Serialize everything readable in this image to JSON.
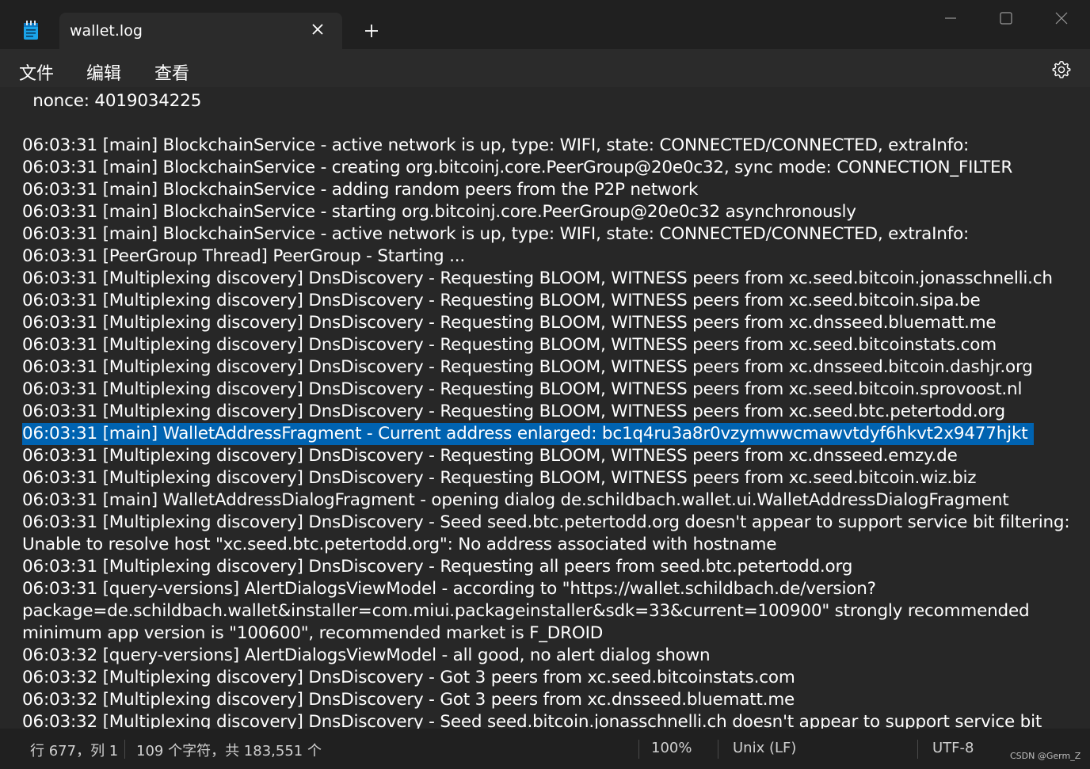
{
  "tab": {
    "title": "wallet.log"
  },
  "menu": {
    "file": "文件",
    "edit": "编辑",
    "view": "查看"
  },
  "icons": {
    "app": "notepad-icon",
    "close_tab": "close-icon",
    "new_tab": "plus-icon",
    "minimize": "minimize-icon",
    "maximize": "maximize-icon",
    "close_window": "close-icon",
    "settings": "gear-icon"
  },
  "colors": {
    "selection": "#0063b1",
    "background": "#272727",
    "text": "#ffffff"
  },
  "lines": [
    "  nonce: 4019034225",
    "",
    "06:03:31 [main] BlockchainService - active network is up, type: WIFI, state: CONNECTED/CONNECTED, extraInfo:",
    "06:03:31 [main] BlockchainService - creating org.bitcoinj.core.PeerGroup@20e0c32, sync mode: CONNECTION_FILTER",
    "06:03:31 [main] BlockchainService - adding random peers from the P2P network",
    "06:03:31 [main] BlockchainService - starting org.bitcoinj.core.PeerGroup@20e0c32 asynchronously",
    "06:03:31 [main] BlockchainService - active network is up, type: WIFI, state: CONNECTED/CONNECTED, extraInfo:",
    "06:03:31 [PeerGroup Thread] PeerGroup - Starting ...",
    "06:03:31 [Multiplexing discovery] DnsDiscovery - Requesting BLOOM, WITNESS peers from xc.seed.bitcoin.jonasschnelli.ch",
    "06:03:31 [Multiplexing discovery] DnsDiscovery - Requesting BLOOM, WITNESS peers from xc.seed.bitcoin.sipa.be",
    "06:03:31 [Multiplexing discovery] DnsDiscovery - Requesting BLOOM, WITNESS peers from xc.dnsseed.bluematt.me",
    "06:03:31 [Multiplexing discovery] DnsDiscovery - Requesting BLOOM, WITNESS peers from xc.seed.bitcoinstats.com",
    "06:03:31 [Multiplexing discovery] DnsDiscovery - Requesting BLOOM, WITNESS peers from xc.dnsseed.bitcoin.dashjr.org",
    "06:03:31 [Multiplexing discovery] DnsDiscovery - Requesting BLOOM, WITNESS peers from xc.seed.bitcoin.sprovoost.nl",
    "06:03:31 [Multiplexing discovery] DnsDiscovery - Requesting BLOOM, WITNESS peers from xc.seed.btc.petertodd.org",
    "06:03:31 [main] WalletAddressFragment - Current address enlarged: bc1q4ru3a8r0vzymwwcmawvtdyf6hkvt2x9477hjkt",
    "06:03:31 [Multiplexing discovery] DnsDiscovery - Requesting BLOOM, WITNESS peers from xc.dnsseed.emzy.de",
    "06:03:31 [Multiplexing discovery] DnsDiscovery - Requesting BLOOM, WITNESS peers from xc.seed.bitcoin.wiz.biz",
    "06:03:31 [main] WalletAddressDialogFragment - opening dialog de.schildbach.wallet.ui.WalletAddressDialogFragment",
    "06:03:31 [Multiplexing discovery] DnsDiscovery - Seed seed.btc.petertodd.org doesn't appear to support service bit filtering:",
    "Unable to resolve host \"xc.seed.btc.petertodd.org\": No address associated with hostname",
    "06:03:31 [Multiplexing discovery] DnsDiscovery - Requesting all peers from seed.btc.petertodd.org",
    "06:03:31 [query-versions] AlertDialogsViewModel - according to \"https://wallet.schildbach.de/version?",
    "package=de.schildbach.wallet&installer=com.miui.packageinstaller&sdk=33&current=100900\" strongly recommended",
    "minimum app version is \"100600\", recommended market is F_DROID",
    "06:03:32 [query-versions] AlertDialogsViewModel - all good, no alert dialog shown",
    "06:03:32 [Multiplexing discovery] DnsDiscovery - Got 3 peers from xc.seed.bitcoinstats.com",
    "06:03:32 [Multiplexing discovery] DnsDiscovery - Got 3 peers from xc.dnsseed.bluematt.me",
    "06:03:32 [Multiplexing discovery] DnsDiscovery - Seed seed.bitcoin.jonasschnelli.ch doesn't appear to support service bit"
  ],
  "selected_line": 15,
  "status": {
    "position": "行 677，列 1",
    "selection": "109 个字符，共 183,551 个",
    "zoom": "100%",
    "line_ending": "Unix (LF)",
    "encoding": "UTF-8"
  },
  "watermark": "CSDN @Germ_Z"
}
